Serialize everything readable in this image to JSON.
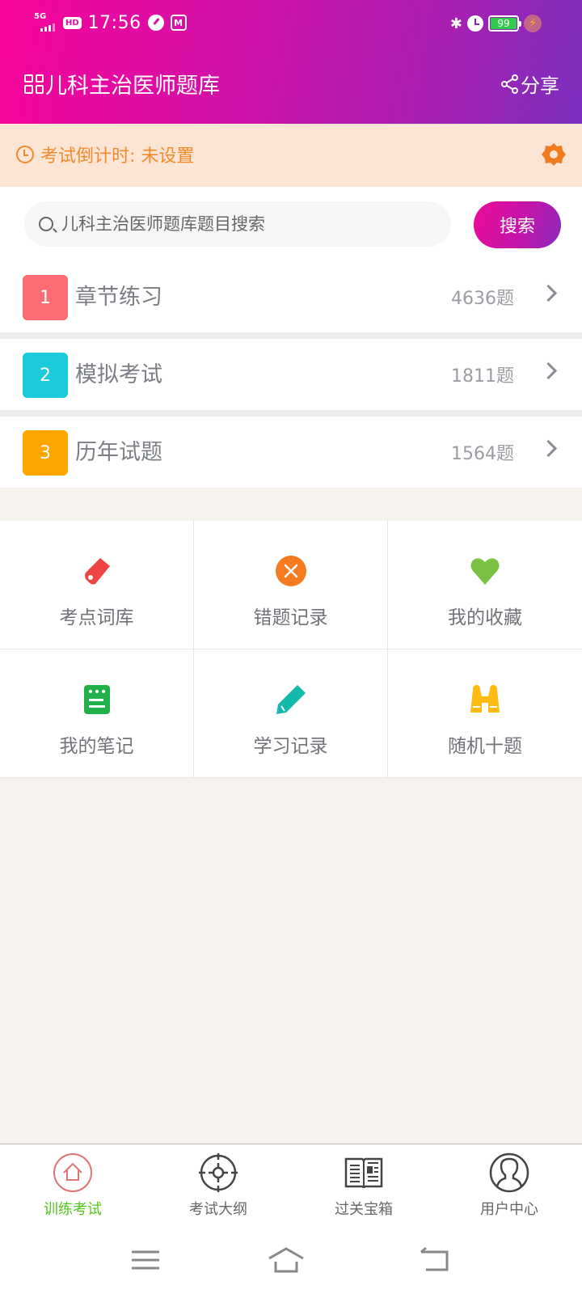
{
  "status_bar": {
    "network": "5G",
    "hd": "HD",
    "time": "17:56",
    "battery": "99",
    "icons": [
      "signal-icon",
      "hd-icon",
      "speedometer-icon",
      "mango-tv-icon",
      "bluetooth-icon",
      "alarm-icon",
      "battery-icon",
      "charging-icon"
    ]
  },
  "app_bar": {
    "title": "儿科主治医师题库",
    "share_label": "分享"
  },
  "countdown": {
    "text": "考试倒计时: 未设置",
    "accent_color": "#f08a2b"
  },
  "search": {
    "placeholder": "儿科主治医师题库题目搜索",
    "value": "",
    "button_label": "搜索"
  },
  "practice_list": [
    {
      "num": "1",
      "label": "章节练习",
      "count": "4636题",
      "color": "#fe6c73"
    },
    {
      "num": "2",
      "label": "模拟考试",
      "count": "1811题",
      "color": "#1ccbdb"
    },
    {
      "num": "3",
      "label": "历年试题",
      "count": "1564题",
      "color": "#ffa500"
    }
  ],
  "features": [
    {
      "label": "考点词库",
      "icon": "tag-icon",
      "color": "#ef4444"
    },
    {
      "label": "错题记录",
      "icon": "wrong-x-icon",
      "color": "#f47b20"
    },
    {
      "label": "我的收藏",
      "icon": "heart-icon",
      "color": "#7ac143"
    },
    {
      "label": "我的笔记",
      "icon": "notebook-icon",
      "color": "#22b04b"
    },
    {
      "label": "学习记录",
      "icon": "pencil-icon",
      "color": "#13b9ad"
    },
    {
      "label": "随机十题",
      "icon": "binoculars-icon",
      "color": "#ffbb12"
    }
  ],
  "tabs": [
    {
      "label": "训练考试",
      "icon": "home-icon",
      "active": true
    },
    {
      "label": "考试大纲",
      "icon": "target-icon",
      "active": false
    },
    {
      "label": "过关宝箱",
      "icon": "newspaper-icon",
      "active": false
    },
    {
      "label": "用户中心",
      "icon": "user-icon",
      "active": false
    }
  ],
  "nav": [
    "menu-icon",
    "home-nav-icon",
    "back-icon"
  ],
  "colors": {
    "header_gradient_start": "#f7049a",
    "header_gradient_end": "#7b2fbf",
    "active_tab": "#52c41a"
  }
}
